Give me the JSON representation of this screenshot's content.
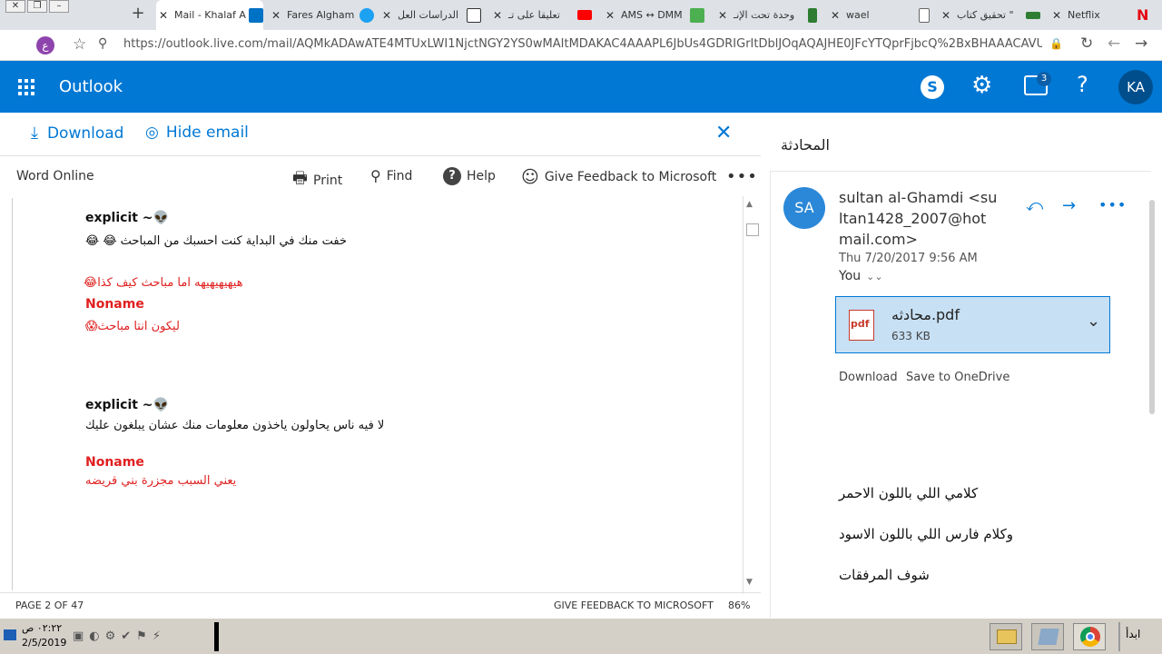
{
  "browser": {
    "tabs": [
      {
        "label": "Mail - Khalaf A",
        "active": true
      },
      {
        "label": "Fares Algham"
      },
      {
        "label": "الدراسات العل"
      },
      {
        "label": "تعليقا على تـ"
      },
      {
        "label": "AMS ↔ DMM"
      },
      {
        "label": "وحدة تحت الإنـ"
      },
      {
        "label": "wael"
      },
      {
        "label": "تحقيق كتاب \""
      },
      {
        "label": "Netflix"
      }
    ],
    "profile_initial": "ع",
    "url": "https://outlook.live.com/mail/AQMkADAwATE4MTUxLWI1NjctNGY2YS0wMAItMDAKAC4AAAPL6JbUs4GDRIGrItDblJOqAQAJHE0JFcYTQprFjbcQ%2BxBHAAACAVUAAAA%3D/id/..."
  },
  "header": {
    "app_name": "Outlook",
    "notification_count": "3",
    "avatar": "KA"
  },
  "attachment_view": {
    "download_label": "Download",
    "hide_email_label": "Hide email",
    "word_online_label": "Word Online",
    "print_label": "Print",
    "find_label": "Find",
    "help_label": "Help",
    "feedback_label": "Give Feedback to Microsoft",
    "page_indicator": "PAGE 2 OF 47",
    "footer_feedback": "GIVE FEEDBACK TO MICROSOFT",
    "zoom": "86%"
  },
  "document": {
    "lines": [
      {
        "text": "explicit ~👽",
        "style": "blk bold"
      },
      {
        "text": "خفت منك في البداية كنت احسبك من المباحث 😂 😂",
        "style": "blk"
      },
      {
        "text": "هيهيهيهيهه اما مباحث كيف كذا😂",
        "style": "red"
      },
      {
        "text": "Noname",
        "style": "red bold"
      },
      {
        "text": "ليكون انتا مباحث😱",
        "style": "red"
      },
      {
        "text": "explicit ~👽",
        "style": "blk bold"
      },
      {
        "text": "لا فيه ناس يحاولون ياخذون معلومات منك عشان يبلغون عليك",
        "style": "blk"
      },
      {
        "text": "Noname",
        "style": "red bold"
      },
      {
        "text": "يعني السبب مجزرة بني قريضه",
        "style": "red"
      }
    ]
  },
  "reading_pane": {
    "conversation_title": "المحادثة",
    "sender_initials": "SA",
    "sender_line1": "sultan al-Ghamdi <su",
    "sender_line2": "ltan1428_2007@hot",
    "sender_line3": "mail.com>",
    "date": "Thu 7/20/2017 9:56 AM",
    "to": "You",
    "attachment_name": "محادثه.pdf",
    "attachment_size": "633 KB",
    "attachment_type": "pdf",
    "download_label": "Download",
    "save_onedrive_label": "Save to OneDrive",
    "body_lines": [
      "كلامي اللي باللون الاحمر",
      "وكلام فارس اللي باللون الاسود",
      "شوف المرفقات"
    ]
  },
  "taskbar": {
    "time": "٠٢:٢٢ ص",
    "date": "2/5/2019",
    "start_label": "ابدأ"
  },
  "colors": {
    "outlook_blue": "#0078d4",
    "red_text": "#e02020",
    "attachment_bg": "#c7e0f4"
  }
}
